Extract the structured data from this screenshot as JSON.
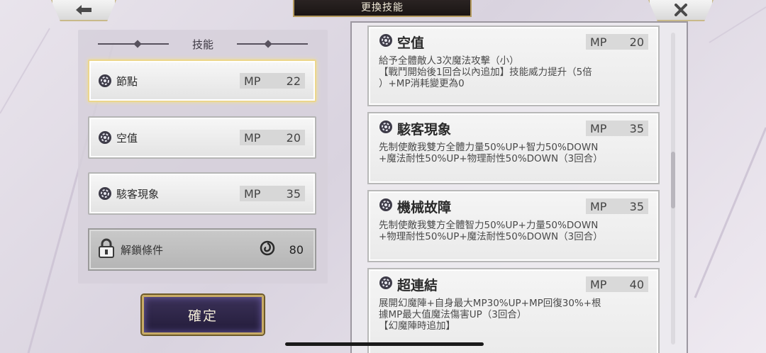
{
  "header": {
    "title": "更換技能",
    "back_icon": "arrow-left-icon",
    "close_icon": "close-icon"
  },
  "left_panel": {
    "title": "技能",
    "slots": [
      {
        "name": "節點",
        "mp_label": "MP",
        "mp": "22",
        "selected": true
      },
      {
        "name": "空值",
        "mp_label": "MP",
        "mp": "20",
        "selected": false
      },
      {
        "name": "駭客現象",
        "mp_label": "MP",
        "mp": "35",
        "selected": false
      }
    ],
    "unlock": {
      "label": "解鎖條件",
      "value": "80",
      "lock_icon": "lock-icon",
      "spiral_icon": "spiral-icon"
    },
    "confirm_label": "確定"
  },
  "skill_list": [
    {
      "name": "空值",
      "mp_label": "MP",
      "mp": "20",
      "desc": "給予全體敵人3次魔法攻擊（小）\n【戰鬥開始後1回合以內追加】技能威力提升（5倍\n）+MP消耗變更為0"
    },
    {
      "name": "駭客現象",
      "mp_label": "MP",
      "mp": "35",
      "desc": "先制使敵我雙方全體力量50%UP+智力50%DOWN\n+魔法耐性50%UP+物理耐性50%DOWN（3回合）"
    },
    {
      "name": "機械故障",
      "mp_label": "MP",
      "mp": "35",
      "desc": "先制使敵我雙方全體智力50%UP+力量50%DOWN\n+物理耐性50%UP+魔法耐性50%DOWN（3回合）"
    },
    {
      "name": "超連結",
      "mp_label": "MP",
      "mp": "40",
      "desc": "展開幻魔陣+自身最大MP30%UP+MP回復30%+根\n據MP最大值魔法傷害UP（3回合）\n【幻魔陣時追加】"
    }
  ]
}
